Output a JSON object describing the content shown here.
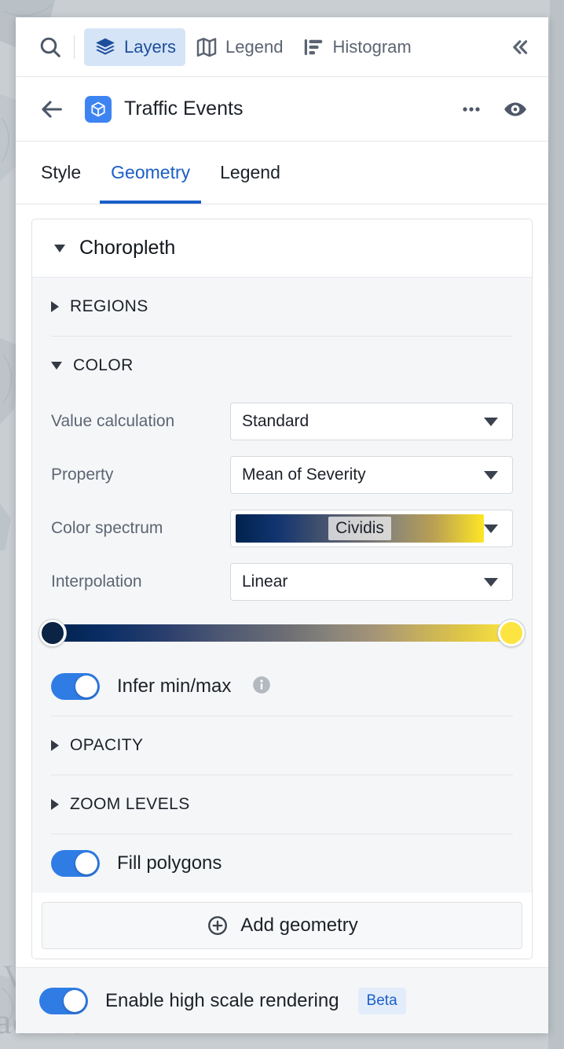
{
  "toolbar": {
    "search_icon": "search-icon",
    "items": [
      {
        "label": "Layers",
        "icon": "layers-icon",
        "active": true
      },
      {
        "label": "Legend",
        "icon": "map-icon",
        "active": false
      },
      {
        "label": "Histogram",
        "icon": "histogram-icon",
        "active": false
      }
    ],
    "collapse_icon": "chevron-double-left-icon"
  },
  "layer_header": {
    "back_icon": "arrow-left-icon",
    "type_icon": "cube-icon",
    "title": "Traffic Events",
    "more_icon": "ellipsis-icon",
    "visibility_icon": "eye-icon"
  },
  "tabs": [
    {
      "label": "Style",
      "active": false
    },
    {
      "label": "Geometry",
      "active": true
    },
    {
      "label": "Legend",
      "active": false
    }
  ],
  "geometry": {
    "card_title": "Choropleth",
    "sections": {
      "regions": {
        "label": "REGIONS",
        "expanded": false
      },
      "color": {
        "label": "COLOR",
        "expanded": true
      },
      "opacity": {
        "label": "OPACITY",
        "expanded": false
      },
      "zoom_levels": {
        "label": "ZOOM LEVELS",
        "expanded": false
      }
    },
    "color": {
      "value_calculation": {
        "label": "Value calculation",
        "value": "Standard"
      },
      "property": {
        "label": "Property",
        "value": "Mean of Severity"
      },
      "color_spectrum": {
        "label": "Color spectrum",
        "value": "Cividis"
      },
      "interpolation": {
        "label": "Interpolation",
        "value": "Linear"
      },
      "range_slider": {
        "min_handle_color": "#0b2344",
        "max_handle_color": "#fde541",
        "min_position": "0",
        "max_position": "100"
      },
      "infer_min_max": {
        "label": "Infer min/max",
        "enabled": true,
        "info_icon": "info-icon"
      }
    },
    "fill_polygons": {
      "label": "Fill polygons",
      "enabled": true
    },
    "add_geometry": {
      "label": "Add geometry",
      "icon": "plus-circle-icon"
    }
  },
  "footer": {
    "high_scale_rendering": {
      "label": "Enable high scale rendering",
      "enabled": true
    },
    "badge": "Beta"
  },
  "map": {
    "label_partial_1": "V",
    "label_partial_2": "acific"
  },
  "colors": {
    "accent_blue": "#1a5fc8",
    "toggle_blue": "#2f7ce5",
    "tab_active_pill": "#d6e4f7",
    "badge_bg": "#e3ecfa",
    "panel_bg": "#ffffff",
    "section_bg": "#f5f6f8"
  }
}
